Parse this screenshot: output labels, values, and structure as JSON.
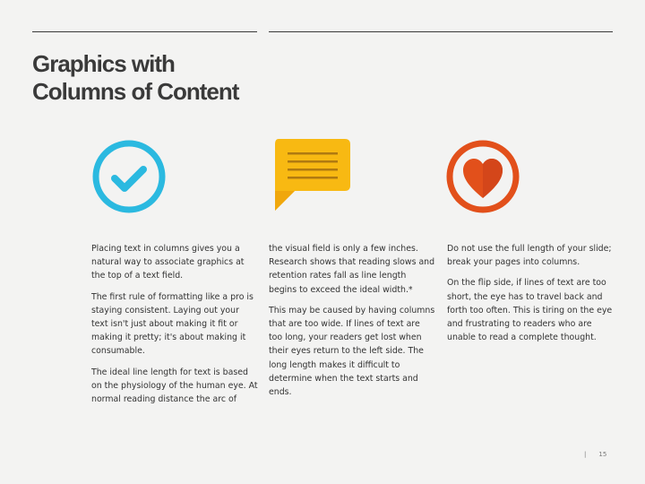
{
  "slide": {
    "title_line1": "Graphics with",
    "title_line2": "Columns of Content",
    "page_number": "15",
    "footer_separator": "|"
  },
  "icons": [
    {
      "name": "checkmark-circle-icon",
      "color": "#2bb9e0"
    },
    {
      "name": "chat-bubble-icon",
      "color": "#f8b912"
    },
    {
      "name": "heart-circle-icon",
      "color": "#e2501b"
    }
  ],
  "columns": [
    {
      "paragraphs": [
        "Placing text in columns gives you a natural way to associate graphics at the top of a text field.",
        "The first rule of formatting like a pro is staying consistent. Laying out your text isn't just about making it fit or making it pretty; it's about making it consumable.",
        "The ideal line length for text is based on the physiology of the human eye. At normal reading distance the arc of"
      ]
    },
    {
      "paragraphs": [
        "the visual field is only a few inches. Research shows that reading slows and retention rates fall as line length begins to exceed the ideal width.*",
        "This may be caused by having columns that are too wide. If lines of text are too long, your readers get lost when their eyes return to the left side. The long length makes it difficult to determine when the text starts and ends."
      ]
    },
    {
      "paragraphs": [
        "Do not use the full length of your slide; break your pages into columns.",
        "On the flip side, if lines of text are too short, the eye has to travel back and forth too often. This is tiring on the eye and frustrating to readers who are unable to read a complete thought."
      ]
    }
  ]
}
